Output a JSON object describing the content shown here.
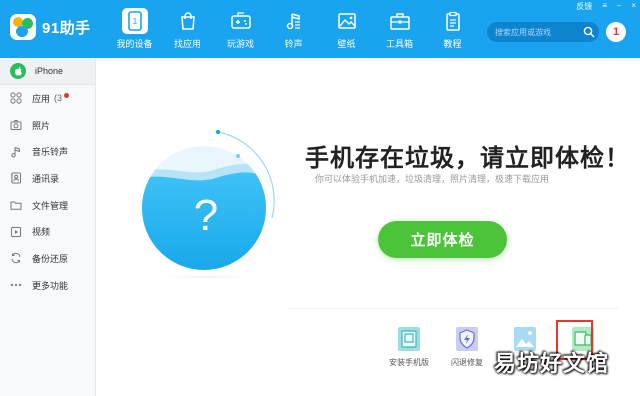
{
  "app": {
    "name": "91助手"
  },
  "window_controls": {
    "feedback": "反馈",
    "menu": "≡",
    "minimize": "–",
    "close": "×"
  },
  "nav": [
    {
      "label": "我的设备",
      "icon": "phone-icon",
      "active": true
    },
    {
      "label": "找应用",
      "icon": "bag-icon",
      "active": false
    },
    {
      "label": "玩游戏",
      "icon": "gamepad-icon",
      "active": false
    },
    {
      "label": "铃声",
      "icon": "music-note-icon",
      "active": false
    },
    {
      "label": "壁纸",
      "icon": "image-icon",
      "active": false
    },
    {
      "label": "工具箱",
      "icon": "toolbox-icon",
      "active": false
    },
    {
      "label": "教程",
      "icon": "clipboard-icon",
      "active": false
    }
  ],
  "search": {
    "placeholder": "搜索应用或游戏"
  },
  "notification": {
    "count": "1"
  },
  "sidebar": {
    "device": "iPhone",
    "items": [
      {
        "label": "应用",
        "count": "(3",
        "icon": "apps-grid-icon",
        "dot": true
      },
      {
        "label": "照片",
        "icon": "camera-icon"
      },
      {
        "label": "音乐铃声",
        "icon": "music-icon"
      },
      {
        "label": "通讯录",
        "icon": "contacts-icon"
      },
      {
        "label": "文件管理",
        "icon": "folder-icon"
      },
      {
        "label": "视频",
        "icon": "video-icon"
      },
      {
        "label": "备份还原",
        "icon": "sync-icon"
      },
      {
        "label": "更多功能",
        "icon": "more-icon"
      }
    ]
  },
  "main": {
    "headline": "手机存在垃圾，请立即体检！",
    "subline": "你可以体验手机加速，垃圾清理，照片清理，极速下载应用",
    "check_button": "立即体检",
    "circle_symbol": "?",
    "tools": [
      {
        "label": "安装手机版",
        "icon": "install-phone-icon"
      },
      {
        "label": "闪退修复",
        "icon": "shield-bolt-icon"
      },
      {
        "label": "",
        "icon": "photo-icon"
      },
      {
        "label": "",
        "icon": "device-manager-icon"
      }
    ]
  },
  "watermark": "易坊好文馆",
  "colors": {
    "brand_blue": "#1aa3ef",
    "green": "#4cc43a",
    "red": "#e8362b"
  }
}
